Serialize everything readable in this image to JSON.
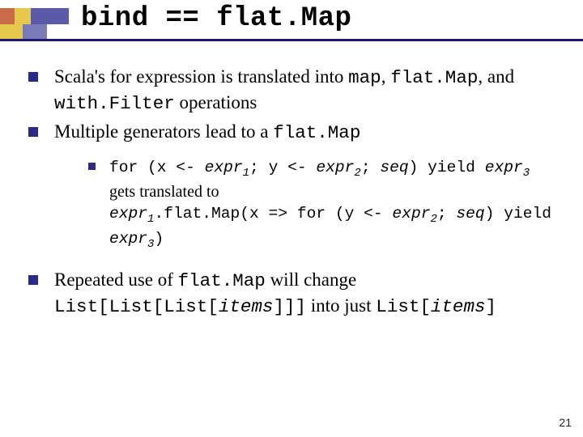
{
  "title": "bind == flat.Map",
  "bullets": {
    "b1_pre": "Scala's for expression is translated into ",
    "b1_c1": "map",
    "b1_sep1": ", ",
    "b1_c2": "flat.Map",
    "b1_mid": ", and ",
    "b1_c3": "with.Filter",
    "b1_post": " operations",
    "b2_pre": "Multiple generators lead to a ",
    "b2_c1": "flat.Map",
    "sub_l1_c1": "for (x <- ",
    "sub_l1_e1": "expr",
    "sub_l1_s1": "1",
    "sub_l1_c2": "; y <- ",
    "sub_l1_e2": "expr",
    "sub_l1_s2": "2",
    "sub_l1_c3": "; ",
    "sub_l1_seq": "seq",
    "sub_l1_c4": ") yield ",
    "sub_l1_e3": "expr",
    "sub_l1_s3": "3",
    "sub_l2": "gets translated to",
    "sub_l3_e1": "expr",
    "sub_l3_s1": "1",
    "sub_l3_c1": ".flat.Map(x => for (y <- ",
    "sub_l3_e2": "expr",
    "sub_l3_s2": "2",
    "sub_l3_c2": "; ",
    "sub_l3_seq": "seq",
    "sub_l3_c3": ") yield ",
    "sub_l3_e3": "expr",
    "sub_l3_s3": "3",
    "sub_l3_c4": ")",
    "b3_pre": "Repeated use of ",
    "b3_c1": "flat.Map",
    "b3_mid": " will change ",
    "b3_c2a": "List[List[List[",
    "b3_it": "items",
    "b3_c2b": "]]]",
    "b3_mid2": " into just ",
    "b3_c3a": "List[",
    "b3_it2": "items",
    "b3_c3b": "]"
  },
  "page": "21"
}
